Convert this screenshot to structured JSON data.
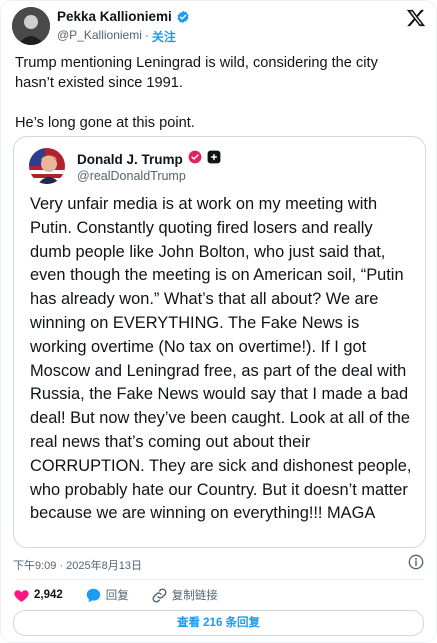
{
  "author": {
    "display_name": "Pekka Kallioniemi",
    "handle": "@P_Kallioniemi",
    "separator": "·",
    "follow_label": "关注"
  },
  "tweet": {
    "paragraph_1": "Trump mentioning Leningrad is wild, considering the city hasn’t existed since 1991.",
    "paragraph_2": "He’s long gone at this point."
  },
  "quoted": {
    "display_name": "Donald J. Trump",
    "handle": "@realDonaldTrump",
    "text": "Very unfair media is at work on my meeting with Putin. Constantly quoting fired losers and really dumb people like John Bolton, who just said that, even though the meeting is on American soil, “Putin has already won.” What’s that all about? We are winning on EVERYTHING. The Fake News is working overtime (No tax on overtime!). If I got Moscow and Leningrad free, as part of the deal with Russia, the Fake News would say that I made a bad deal! But now they’ve been caught. Look at all of the real news that’s coming out about their CORRUPTION. They are sick and dishonest people, who probably hate our Country. But it doesn’t matter because we are winning on everything!!! MAGA"
  },
  "meta": {
    "timestamp": "下午9:09 · 2025年8月13日"
  },
  "actions": {
    "like_count": "2,942",
    "reply_label": "回复",
    "copy_link_label": "复制链接"
  },
  "read_replies_label": "查看 216 条回复",
  "colors": {
    "accent": "#1d9bf0",
    "like": "#f91880",
    "text": "#0f1419",
    "muted": "#536471",
    "border": "#cfd9de"
  }
}
